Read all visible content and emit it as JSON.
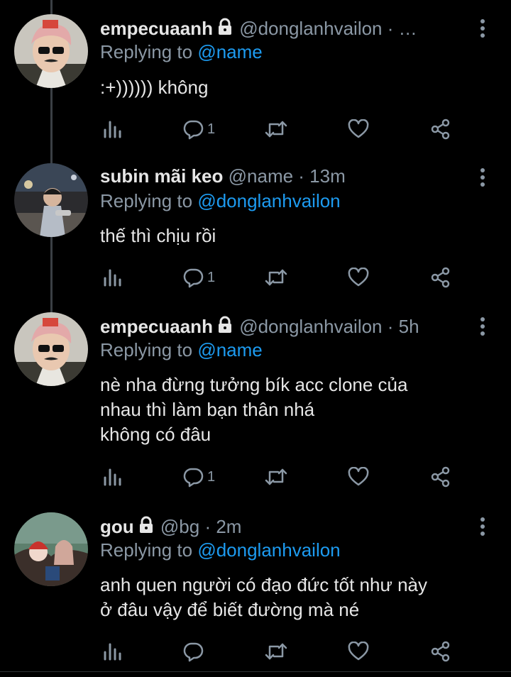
{
  "tweets": [
    {
      "name": "empecuaanh",
      "handle": "@donglanhvailon",
      "time": "· …",
      "reply_prefix": "Replying to",
      "reply_to": "@name",
      "lines": [
        ":+)))))) không"
      ],
      "reply_count": "1",
      "locked": true
    },
    {
      "name": "subin mãi keo",
      "handle": "@name",
      "time": "· 13m",
      "reply_prefix": "Replying to",
      "reply_to": "@donglanhvailon",
      "lines": [
        "thế thì chịu rồi"
      ],
      "reply_count": "1",
      "locked": false
    },
    {
      "name": "empecuaanh",
      "handle": "@donglanhvailon",
      "time": "· 5h",
      "reply_prefix": "Replying to",
      "reply_to": "@name",
      "lines": [
        "nè nha đừng tưởng bík acc clone của",
        "nhau thì làm bạn thân nhá",
        "không có đâu"
      ],
      "reply_count": "1",
      "locked": true
    },
    {
      "name": "gou",
      "handle": "@bg",
      "time": "· 2m",
      "reply_prefix": "Replying to",
      "reply_to": "@donglanhvailon",
      "lines": [
        "anh quen người có đạo đức tốt như này",
        "ở đâu vậy để biết đường mà né"
      ],
      "reply_count": "",
      "locked": true
    }
  ],
  "icons": {
    "analytics": "analytics-icon",
    "reply": "reply-icon",
    "retweet": "retweet-icon",
    "like": "like-icon",
    "share": "share-icon",
    "more": "more-vertical-icon",
    "lock": "lock-icon"
  },
  "colors": {
    "background": "#000000",
    "text": "#e6e6e6",
    "muted": "#8b98a5",
    "mention": "#1d9bf0",
    "thread_line": "#3a3f44"
  }
}
